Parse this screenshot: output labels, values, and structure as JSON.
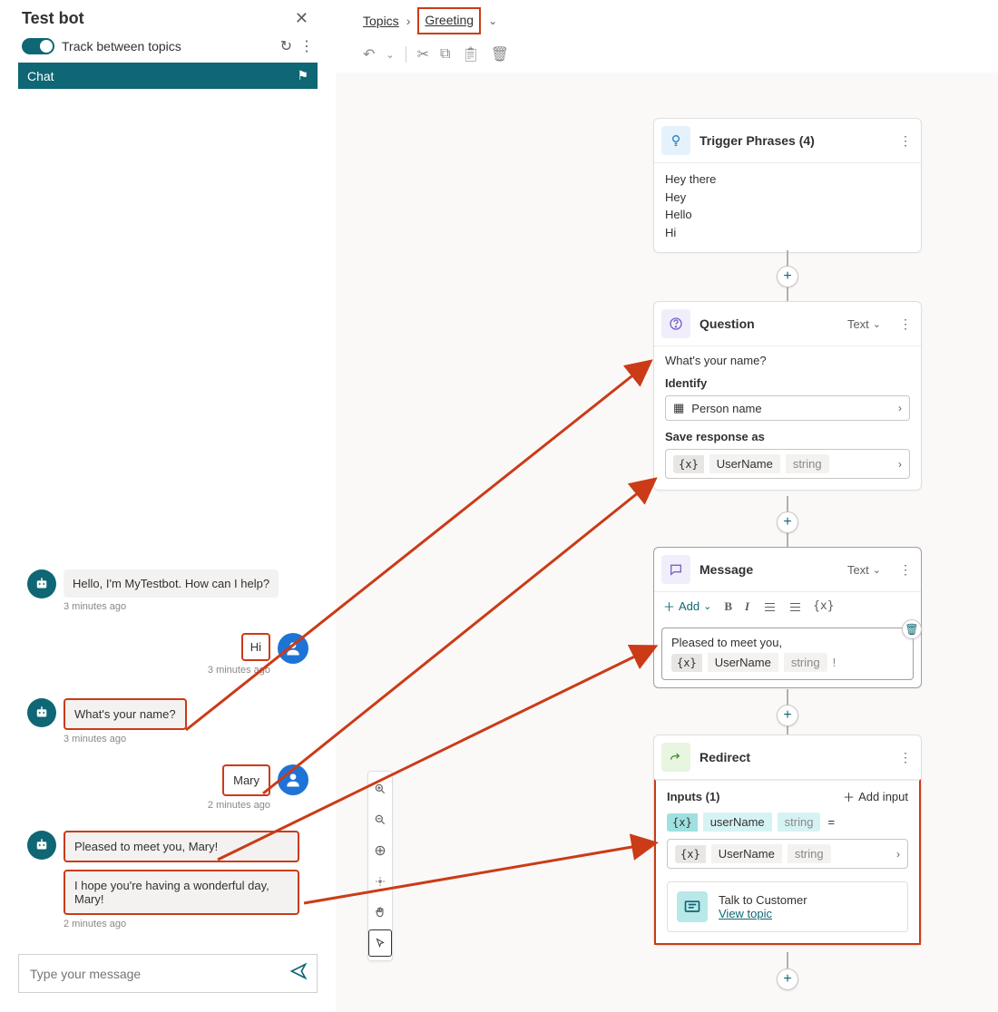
{
  "testPanel": {
    "title": "Test bot",
    "trackLabel": "Track between topics",
    "chatTab": "Chat",
    "input": {
      "placeholder": "Type your message"
    }
  },
  "chat": {
    "m1": {
      "text": "Hello, I'm MyTestbot. How can I help?",
      "ts": "3 minutes ago"
    },
    "u1": {
      "text": "Hi",
      "ts": "3 minutes ago"
    },
    "m2": {
      "text": "What's your name?",
      "ts": "3 minutes ago"
    },
    "u2": {
      "text": "Mary",
      "ts": "2 minutes ago"
    },
    "m3": {
      "text": "Pleased to meet you, Mary!"
    },
    "m4": {
      "text": "I hope you're having a wonderful day, Mary!",
      "ts": "2 minutes ago"
    }
  },
  "breadcrumb": {
    "root": "Topics",
    "current": "Greeting"
  },
  "nodes": {
    "trigger": {
      "title": "Trigger Phrases (4)",
      "phrases": {
        "p1": "Hey there",
        "p2": "Hey",
        "p3": "Hello",
        "p4": "Hi"
      }
    },
    "question": {
      "title": "Question",
      "typeLabel": "Text",
      "prompt": "What's your name?",
      "identifyLabel": "Identify",
      "identifyValue": "Person name",
      "saveLabel": "Save response as",
      "varName": "UserName",
      "varType": "string"
    },
    "message": {
      "title": "Message",
      "typeLabel": "Text",
      "addLabel": "Add",
      "text": "Pleased to meet you,",
      "varName": "UserName",
      "varType": "string",
      "varBrace": "{x}"
    },
    "redirect": {
      "title": "Redirect",
      "inputsLabel": "Inputs (1)",
      "addInputLabel": "Add input",
      "paramName": "userName",
      "paramType": "string",
      "eq": "=",
      "varName": "UserName",
      "varType": "string",
      "topicName": "Talk to Customer",
      "viewTopic": "View topic"
    }
  }
}
